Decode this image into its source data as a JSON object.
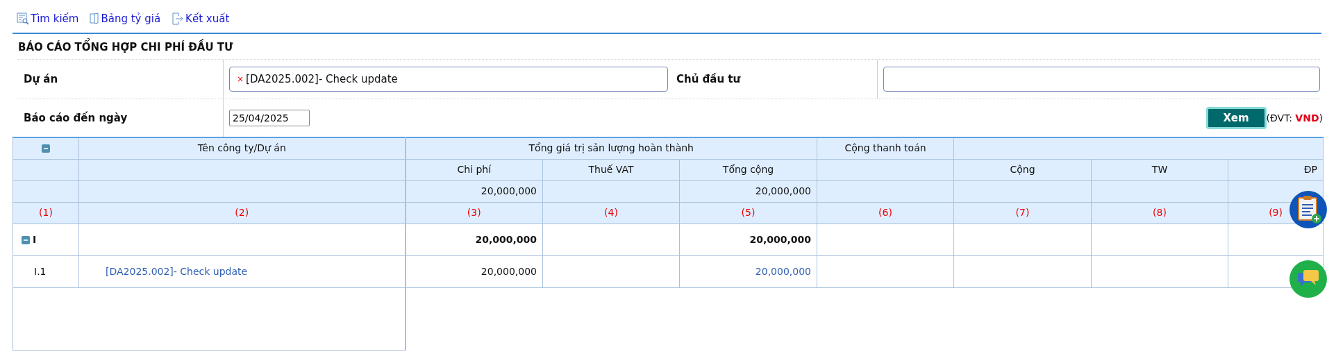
{
  "toolbar": [
    {
      "label": "Tìm kiếm",
      "kind": "search"
    },
    {
      "label": "Bảng tỷ giá",
      "kind": "book"
    },
    {
      "label": "Kết xuất",
      "kind": "export"
    }
  ],
  "title": "BÁO CÁO TỔNG HỢP CHI PHÍ ĐẦU TƯ",
  "filters": {
    "project": {
      "label": "Dự án",
      "tags": [
        {
          "remove": "×",
          "text": "[DA2025.002]- Check update"
        }
      ]
    },
    "owner": {
      "label": "Chủ đầu tư"
    },
    "date": {
      "label": "Báo cáo đến ngày",
      "value": "25/04/2025"
    },
    "view_button": "Xem",
    "unit": {
      "open": "(ĐVT:",
      "value": "VND",
      "close": ")"
    }
  },
  "table": {
    "header_rows": [
      [
        {
          "kind": "toggle",
          "expanded": true
        },
        {
          "text": "Tên công ty/Dự án"
        },
        {
          "text": "Tổng giá trị sản lượng hoàn thành"
        },
        {
          "text": "Cộng thanh toán"
        },
        {}
      ],
      [
        {},
        {},
        {
          "text": "Chi phí"
        },
        {
          "text": "Thuế VAT"
        },
        {
          "text": "Tổng cộng"
        },
        {},
        {
          "text": "Cộng"
        },
        {
          "text": "TW"
        },
        {
          "text": "ĐP"
        }
      ],
      [
        {},
        {},
        {
          "text": "20,000,000"
        },
        {},
        {
          "text": "20,000,000"
        },
        {},
        {},
        {},
        {}
      ],
      [
        {
          "text": "(1)",
          "kind": "index"
        },
        {
          "text": "(2)",
          "kind": "index"
        },
        {
          "text": "(3)",
          "kind": "index"
        },
        {
          "text": "(4)",
          "kind": "index"
        },
        {
          "text": "(5)",
          "kind": "index"
        },
        {
          "text": "(6)",
          "kind": "index"
        },
        {
          "text": "(7)",
          "kind": "index"
        },
        {
          "text": "(8)",
          "kind": "index"
        },
        {
          "text": "(9)",
          "kind": "index"
        }
      ]
    ],
    "rows": [
      {
        "kind": "group",
        "expanded": true,
        "stt": "I",
        "chi_phi": "20,000,000",
        "tong_cong": "20,000,000"
      },
      {
        "kind": "item",
        "stt": "I.1",
        "name": "[DA2025.002]- Check update",
        "chi_phi": "20,000,000",
        "tong_cong": "20,000,000"
      }
    ]
  }
}
